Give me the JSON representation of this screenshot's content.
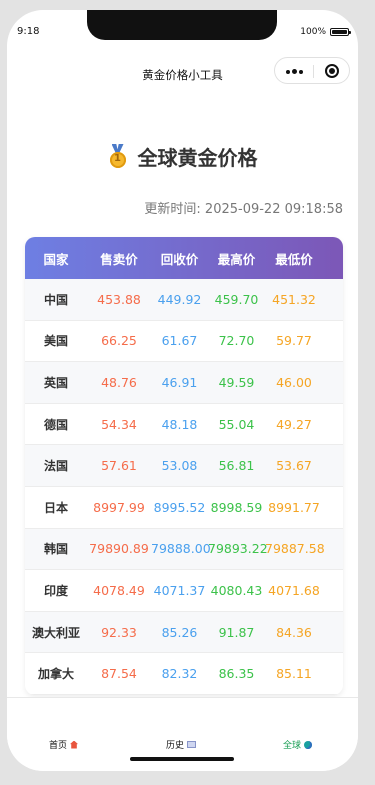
{
  "status_bar": {
    "time": "9:18",
    "battery": "100%"
  },
  "nav": {
    "title": "黄金价格小工具",
    "more_icon": "more-dots-icon",
    "close_icon": "target-icon"
  },
  "heading": {
    "icon": "gold-medal-icon",
    "text": "全球黄金价格"
  },
  "update_time": "更新时间: 2025-09-22 09:18:58",
  "table": {
    "headers": [
      "国家",
      "售卖价",
      "回收价",
      "最高价",
      "最低价"
    ],
    "rows": [
      {
        "country": "中国",
        "sell": "453.88",
        "buy": "449.92",
        "high": "459.70",
        "low": "451.32"
      },
      {
        "country": "美国",
        "sell": "66.25",
        "buy": "61.67",
        "high": "72.70",
        "low": "59.77"
      },
      {
        "country": "英国",
        "sell": "48.76",
        "buy": "46.91",
        "high": "49.59",
        "low": "46.00"
      },
      {
        "country": "德国",
        "sell": "54.34",
        "buy": "48.18",
        "high": "55.04",
        "low": "49.27"
      },
      {
        "country": "法国",
        "sell": "57.61",
        "buy": "53.08",
        "high": "56.81",
        "low": "53.67"
      },
      {
        "country": "日本",
        "sell": "8997.99",
        "buy": "8995.52",
        "high": "8998.59",
        "low": "8991.77"
      },
      {
        "country": "韩国",
        "sell": "79890.89",
        "buy": "79888.00",
        "high": "79893.22",
        "low": "79887.58"
      },
      {
        "country": "印度",
        "sell": "4078.49",
        "buy": "4071.37",
        "high": "4080.43",
        "low": "4071.68"
      },
      {
        "country": "澳大利亚",
        "sell": "92.33",
        "buy": "85.26",
        "high": "91.87",
        "low": "84.36"
      },
      {
        "country": "加拿大",
        "sell": "87.54",
        "buy": "82.32",
        "high": "86.35",
        "low": "85.11"
      }
    ]
  },
  "tabbar": {
    "items": [
      {
        "label": "首页",
        "icon": "home-icon"
      },
      {
        "label": "历史",
        "icon": "chart-icon"
      },
      {
        "label": "全球",
        "icon": "globe-icon"
      }
    ],
    "active_index": 2
  },
  "colors": {
    "sell": "#f56c4a",
    "buy": "#4aa0ee",
    "high": "#3cc24a",
    "low": "#f5a524",
    "active_tab": "#1a9e55"
  }
}
